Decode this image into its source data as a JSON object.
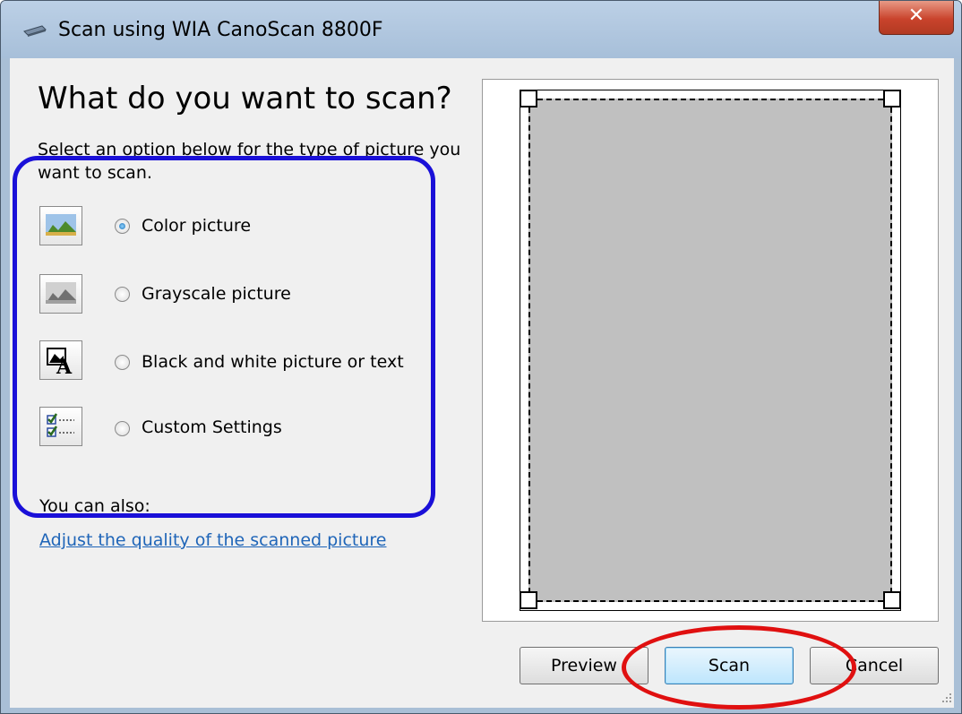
{
  "window": {
    "title": "Scan using WIA CanoScan 8800F",
    "close_icon": "close-x-icon",
    "title_icon": "scanner-icon"
  },
  "content": {
    "heading": "What do you want to scan?",
    "description": "Select an option below for the type of picture you want to scan.",
    "options": [
      {
        "label": "Color picture",
        "icon": "color-photo-icon",
        "selected": true
      },
      {
        "label": "Grayscale picture",
        "icon": "grayscale-photo-icon",
        "selected": false
      },
      {
        "label": "Black and white picture or text",
        "icon": "black-white-text-icon",
        "selected": false
      },
      {
        "label": "Custom Settings",
        "icon": "custom-settings-icon",
        "selected": false
      }
    ],
    "also_label": "You can also:",
    "quality_link": "Adjust the quality of the scanned picture"
  },
  "buttons": {
    "preview": "Preview",
    "scan": "Scan",
    "cancel": "Cancel"
  },
  "annotations": {
    "blue_highlight_color": "#1a10d8",
    "red_highlight_color": "#e01010"
  }
}
